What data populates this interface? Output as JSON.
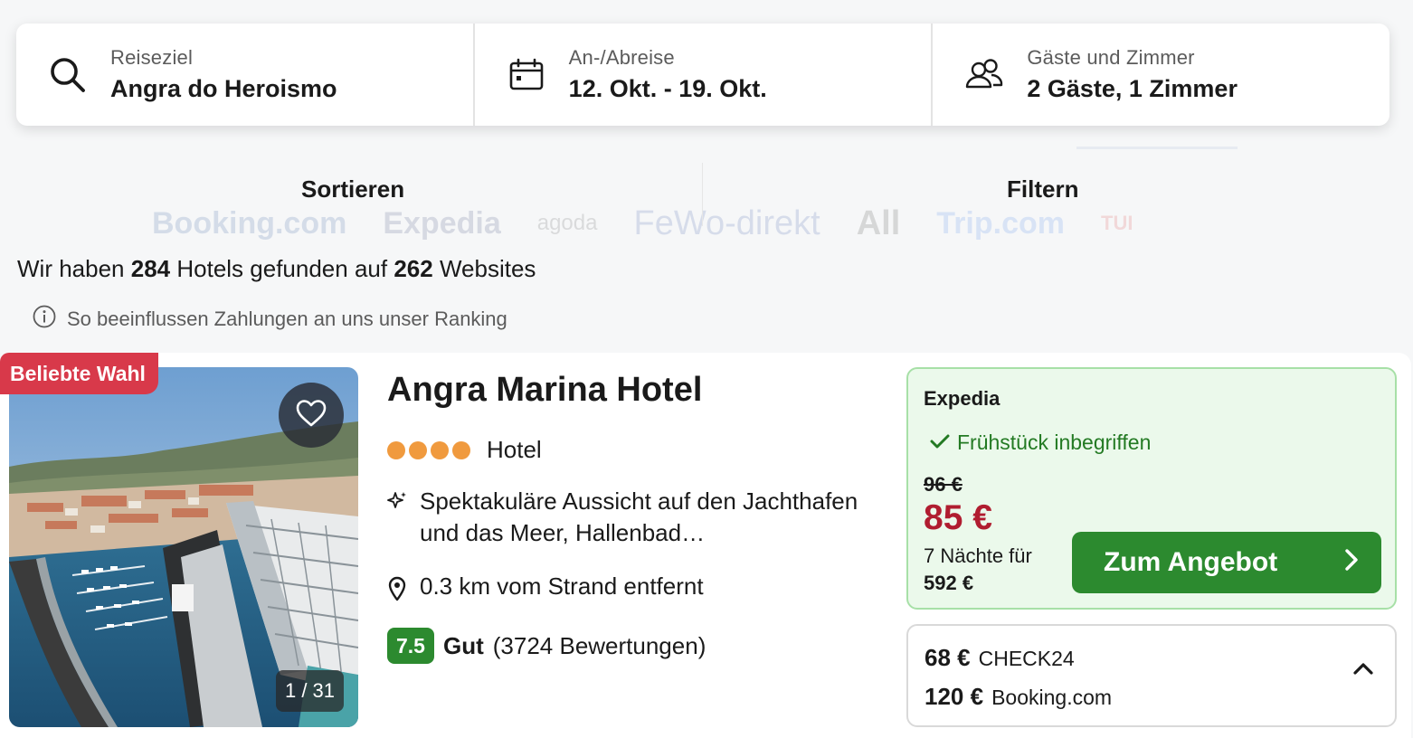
{
  "search": {
    "destination_label": "Reiseziel",
    "destination_value": "Angra do Heroismo",
    "dates_label": "An-/Abreise",
    "dates_value": "12. Okt. - 19. Okt.",
    "guests_label": "Gäste und Zimmer",
    "guests_value": "2 Gäste, 1 Zimmer"
  },
  "toolbar": {
    "sort_label": "Sortieren",
    "filter_label": "Filtern",
    "background_logos": [
      "Booking.com",
      "Expedia",
      "agoda",
      "FeWo-direkt",
      "All",
      "Trip.com",
      "TUI"
    ]
  },
  "results": {
    "prefix": "Wir haben",
    "hotel_count": "284",
    "middle": "Hotels gefunden auf",
    "site_count": "262",
    "suffix": "Websites"
  },
  "ranking_note": "So beeinflussen Zahlungen an uns unser Ranking",
  "hotel": {
    "badge": "Beliebte Wahl",
    "photo_counter": "1 / 31",
    "name": "Angra Marina Hotel",
    "stars": 4,
    "type": "Hotel",
    "highlight": "Spektakuläre Aussicht auf den Jachthafen und das Meer, Hallenbad…",
    "distance": "0.3 km vom Strand entfernt",
    "score": "7.5",
    "score_word": "Gut",
    "reviews": "(3724 Bewertungen)"
  },
  "deal": {
    "provider": "Expedia",
    "perk": "Frühstück inbegriffen",
    "old_price": "96 €",
    "price": "85 €",
    "nights_text": "7 Nächte für",
    "total": "592 €",
    "cta_label": "Zum Angebot"
  },
  "other_offers": [
    {
      "price": "68 €",
      "provider": "CHECK24"
    },
    {
      "price": "120 €",
      "provider": "Booking.com"
    }
  ],
  "colors": {
    "badge": "#d8394a",
    "cta": "#2c8a2f",
    "deal_bg": "#ebf9eb",
    "price_red": "#b01d30",
    "stars": "#f09a3e"
  }
}
